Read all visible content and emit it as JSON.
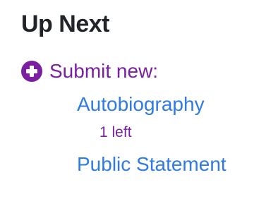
{
  "section": {
    "title": "Up Next"
  },
  "submit": {
    "icon": "plus-circle-icon",
    "label": "Submit new:",
    "color": "#7a1fa2"
  },
  "options": [
    {
      "label": "Autobiography",
      "note": "1 left"
    },
    {
      "label": "Public Statement",
      "note": ""
    }
  ],
  "colors": {
    "title": "#212529",
    "link": "#2f7ae5",
    "accent": "#7a1fa2"
  }
}
